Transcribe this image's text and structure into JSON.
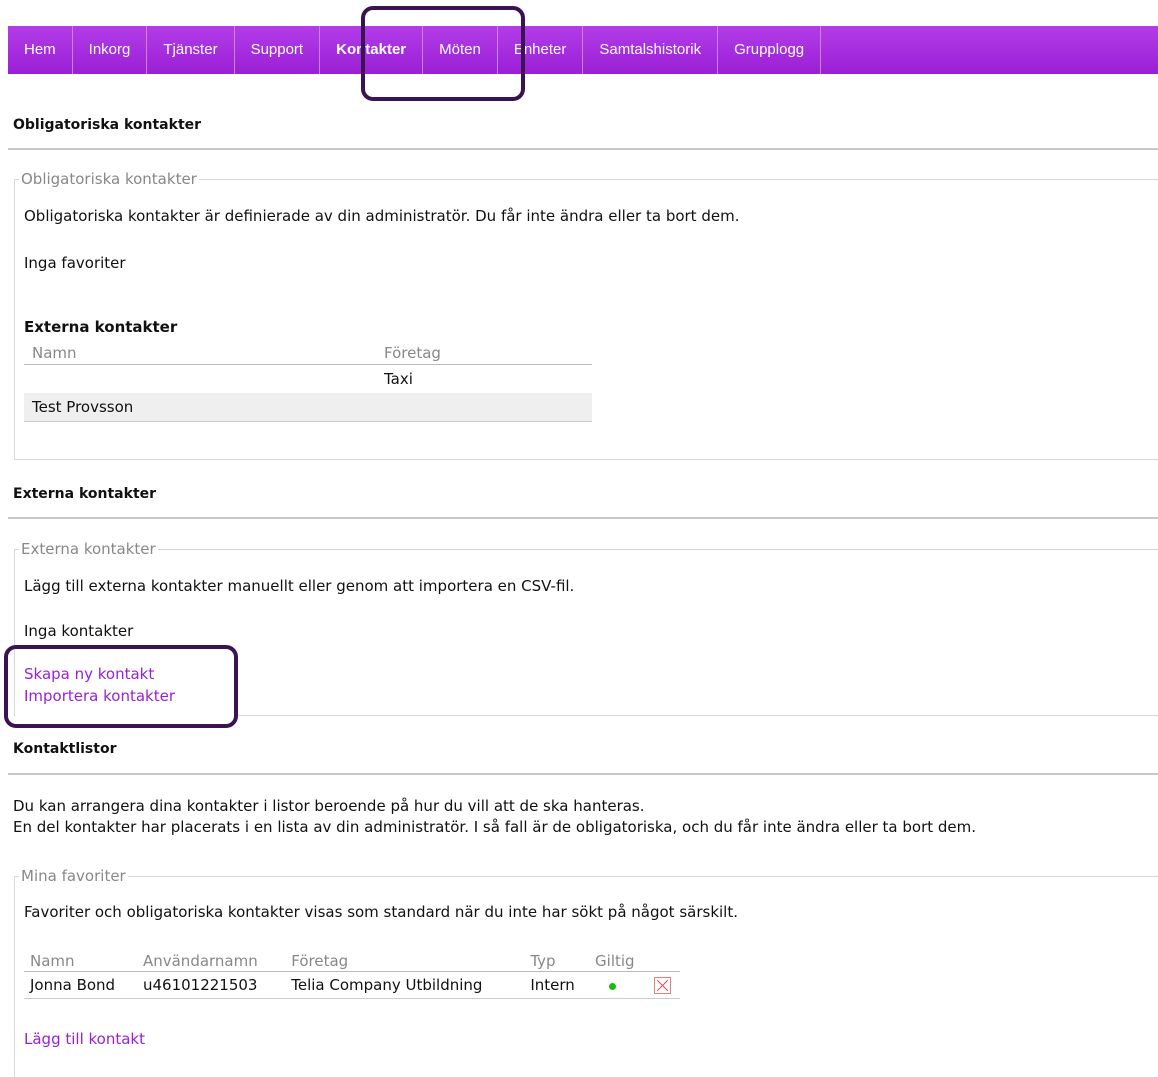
{
  "nav": {
    "items": [
      {
        "label": "Hem"
      },
      {
        "label": "Inkorg"
      },
      {
        "label": "Tjänster"
      },
      {
        "label": "Support"
      },
      {
        "label": "Kontakter"
      },
      {
        "label": "Möten"
      },
      {
        "label": "Enheter"
      },
      {
        "label": "Samtalshistorik"
      },
      {
        "label": "Grupplogg"
      }
    ],
    "active": "Kontakter",
    "color": "#a52ce0"
  },
  "mandatory": {
    "title": "Obligatoriska kontakter",
    "legend": "Obligatoriska kontakter",
    "description": "Obligatoriska kontakter är definierade av din administratör. Du får inte ändra eller ta bort dem.",
    "no_favorites": "Inga favoriter",
    "external_heading": "Externa kontakter",
    "columns": [
      "Namn",
      "Företag"
    ],
    "rows": [
      {
        "name": "",
        "company": "Taxi"
      },
      {
        "name": "Test Provsson",
        "company": ""
      }
    ]
  },
  "external": {
    "title": "Externa kontakter",
    "legend": "Externa kontakter",
    "description": "Lägg till externa kontakter manuellt eller genom att importera en CSV-fil.",
    "no_contacts": "Inga kontakter",
    "create_link": "Skapa ny kontakt",
    "import_link": "Importera kontakter"
  },
  "lists": {
    "title": "Kontaktlistor",
    "line1": "Du kan arrangera dina kontakter i listor beroende på hur du vill att de ska hanteras.",
    "line2": "En del kontakter har placerats i en lista av din administratör. I så fall är de obligatoriska, och du får inte ändra eller ta bort dem.",
    "favorites": {
      "legend": "Mina favoriter",
      "description": "Favoriter och obligatoriska kontakter visas som standard när du inte har sökt på något särskilt.",
      "columns": [
        "Namn",
        "Användarnamn",
        "Företag",
        "Typ",
        "Giltig"
      ],
      "rows": [
        {
          "name": "Jonna Bond",
          "username": "u46101221503",
          "company": "Telia Company Utbildning",
          "type": "Intern",
          "valid": true
        }
      ],
      "add_link": "Lägg till kontakt"
    }
  },
  "colors": {
    "link": "#9b1fd6",
    "highlight": "#3a1452",
    "valid": "#11c011"
  }
}
